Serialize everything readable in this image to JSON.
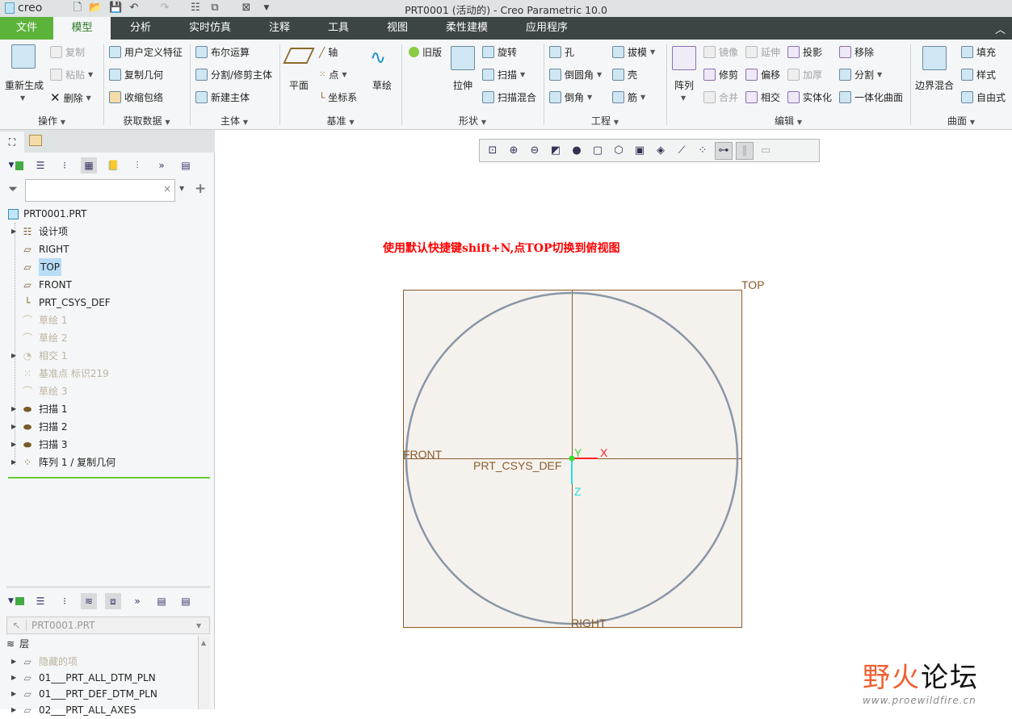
{
  "window": {
    "title": "PRT0001 (活动的) - Creo Parametric 10.0",
    "logo": "creo"
  },
  "quick_access": [
    "new-icon",
    "open-icon",
    "save-icon",
    "undo-icon",
    "redo-icon",
    "regenerate-icon",
    "windows-icon",
    "close-icon",
    "customize-icon"
  ],
  "menu": {
    "tabs": [
      "文件",
      "模型",
      "分析",
      "实时仿真",
      "注释",
      "工具",
      "视图",
      "柔性建模",
      "应用程序"
    ],
    "active": "模型"
  },
  "ribbon": {
    "groups": [
      {
        "label": "操作",
        "items": [
          "重新生成",
          "复制",
          "粘贴",
          "删除"
        ]
      },
      {
        "label": "获取数据",
        "items": [
          "用户定义特征",
          "复制几何",
          "收缩包络"
        ]
      },
      {
        "label": "主体",
        "items": [
          "布尔运算",
          "分割/修剪主体",
          "新建主体"
        ]
      },
      {
        "label": "基准",
        "items": [
          "平面",
          "轴",
          "点",
          "坐标系",
          "草绘"
        ]
      },
      {
        "label": "形状",
        "items": [
          "旧版",
          "拉伸",
          "旋转",
          "扫描",
          "扫描混合"
        ]
      },
      {
        "label": "工程",
        "items": [
          "孔",
          "倒圆角",
          "倒角",
          "拔模",
          "壳",
          "筋"
        ]
      },
      {
        "label": "编辑",
        "items": [
          "阵列",
          "镜像",
          "修剪",
          "合并",
          "延伸",
          "偏移",
          "相交",
          "投影",
          "加厚",
          "实体化",
          "移除",
          "分割",
          "一体化曲面"
        ]
      },
      {
        "label": "曲面",
        "items": [
          "边界混合",
          "填充",
          "样式",
          "自由式"
        ]
      }
    ]
  },
  "model_tree": {
    "root": "PRT0001.PRT",
    "filter_placeholder": "",
    "items": [
      {
        "label": "设计项",
        "expandable": true,
        "dim": false,
        "icon": "design-items-icon"
      },
      {
        "label": "RIGHT",
        "expandable": false,
        "dim": false,
        "icon": "datum-plane-icon"
      },
      {
        "label": "TOP",
        "expandable": false,
        "dim": false,
        "icon": "datum-plane-icon",
        "selected": true
      },
      {
        "label": "FRONT",
        "expandable": false,
        "dim": false,
        "icon": "datum-plane-icon"
      },
      {
        "label": "PRT_CSYS_DEF",
        "expandable": false,
        "dim": false,
        "icon": "csys-icon"
      },
      {
        "label": "草绘 1",
        "expandable": false,
        "dim": true,
        "icon": "sketch-icon"
      },
      {
        "label": "草绘 2",
        "expandable": false,
        "dim": true,
        "icon": "sketch-icon"
      },
      {
        "label": "相交 1",
        "expandable": true,
        "dim": true,
        "icon": "intersect-icon"
      },
      {
        "label": "基准点 标识219",
        "expandable": false,
        "dim": true,
        "icon": "datum-point-icon"
      },
      {
        "label": "草绘 3",
        "expandable": false,
        "dim": true,
        "icon": "sketch-icon"
      },
      {
        "label": "扫描 1",
        "expandable": true,
        "dim": false,
        "icon": "sweep-icon"
      },
      {
        "label": "扫描 2",
        "expandable": true,
        "dim": false,
        "icon": "sweep-icon"
      },
      {
        "label": "扫描 3",
        "expandable": true,
        "dim": false,
        "icon": "sweep-icon"
      },
      {
        "label": "阵列 1 / 复制几何",
        "expandable": true,
        "dim": false,
        "icon": "pattern-icon"
      }
    ]
  },
  "layer_tree": {
    "model_select": "PRT0001.PRT",
    "root": "层",
    "items": [
      {
        "label": "隐藏的项",
        "dim": true
      },
      {
        "label": "01___PRT_ALL_DTM_PLN",
        "dim": false
      },
      {
        "label": "01___PRT_DEF_DTM_PLN",
        "dim": false
      },
      {
        "label": "02___PRT_ALL_AXES",
        "dim": false
      }
    ]
  },
  "view_toolbar": [
    "refit-icon",
    "zoom-in-icon",
    "zoom-out-icon",
    "repaint-icon",
    "display-style-icon",
    "saved-orientations-icon",
    "view-manager-icon",
    "perspective-icon",
    "section-icon",
    "datum-display-icon",
    "annotation-display-icon",
    "spin-center-icon",
    "pause-icon",
    "stop-icon"
  ],
  "graphics": {
    "instruction": "使用默认快捷键shift+N,点TOP切换到俯视图",
    "labels": {
      "top": "TOP",
      "front": "FRONT",
      "right": "RIGHT",
      "csys": "PRT_CSYS_DEF",
      "x": "X",
      "y": "Y",
      "z": "Z"
    },
    "colors": {
      "datum": "#8b5a2b",
      "plane_fill": "#f5f2ee",
      "circle": "#8a96a6",
      "x_axis": "#ff2020",
      "y_axis": "#30e030",
      "z_axis": "#20e0e0",
      "instruction": "#ff0000"
    }
  },
  "watermark": {
    "text": "野火论坛",
    "url": "www.proewildfire.cn"
  }
}
